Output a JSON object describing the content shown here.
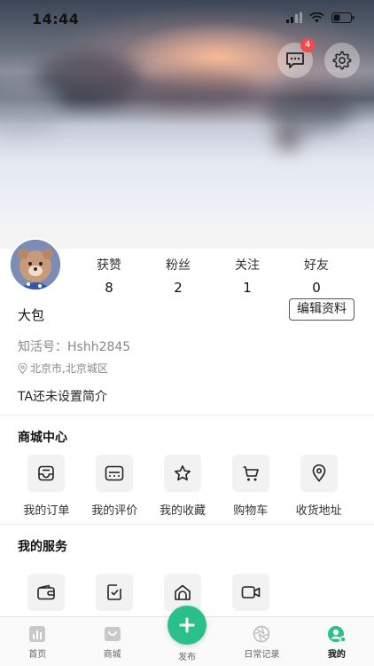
{
  "status_bar": {
    "time": "14:44"
  },
  "header": {
    "message_badge": "4"
  },
  "profile": {
    "stats": [
      {
        "label": "获赞",
        "value": "8"
      },
      {
        "label": "粉丝",
        "value": "2"
      },
      {
        "label": "关注",
        "value": "1"
      },
      {
        "label": "好友",
        "value": "0"
      }
    ],
    "edit_label": "编辑资料",
    "nickname": "大包",
    "user_id": "知活号：Hshh2845",
    "location": "北京市,北京城区",
    "bio": "TA还未设置简介"
  },
  "mall": {
    "title": "商城中心",
    "items": [
      {
        "label": "我的订单",
        "icon": "inbox-icon"
      },
      {
        "label": "我的评价",
        "icon": "comment-card-icon"
      },
      {
        "label": "我的收藏",
        "icon": "star-icon"
      },
      {
        "label": "购物车",
        "icon": "cart-icon"
      },
      {
        "label": "收货地址",
        "icon": "location-pin-icon"
      }
    ]
  },
  "services": {
    "title": "我的服务",
    "items": [
      {
        "icon": "wallet-icon"
      },
      {
        "icon": "checklist-icon"
      },
      {
        "icon": "home-icon"
      },
      {
        "icon": "video-icon"
      }
    ]
  },
  "tabbar": {
    "tabs": [
      {
        "label": "首页",
        "icon": "chart-icon"
      },
      {
        "label": "商城",
        "icon": "bag-icon"
      },
      {
        "label": "发布",
        "icon": "plus-icon"
      },
      {
        "label": "日常记录",
        "icon": "aperture-icon"
      },
      {
        "label": "我的",
        "icon": "profile-icon"
      }
    ],
    "active_color": "#2bc08a"
  }
}
